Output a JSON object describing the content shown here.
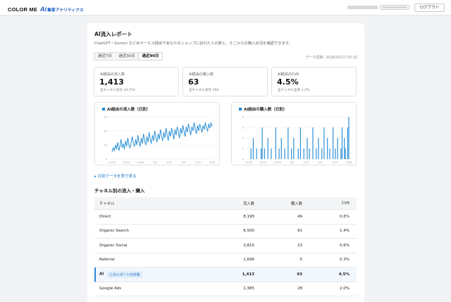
{
  "header": {
    "brand": "COLOR ME",
    "product_ai": "Ai",
    "product_name": "集客アナリティクス",
    "logout_label": "ログアウト"
  },
  "report": {
    "title": "AI流入レポート",
    "subtitle": "ChatGPT・Gemini などAIサービス経由であなたのショップに訪れた人の数と、そこからの購入状況を確認できます。",
    "periods": [
      "過近7日",
      "過近30日",
      "過近90日"
    ],
    "active_period": "過近90日",
    "updated": "データ更新: 2026/02/27 03:10"
  },
  "kpis": [
    {
      "label": "AI経由の流入数",
      "value": "1,413",
      "sub": "全チャネル合計 24,714"
    },
    {
      "label": "AI経由の購入数",
      "value": "63",
      "sub": "全チャネル合計 294"
    },
    {
      "label": "AI経由のCVR",
      "value": "4.5%",
      "sub": "全チャネル全体 1.2%"
    }
  ],
  "charts": {
    "visits_title": "AI経由の流入数（日別）",
    "purchases_title": "AI経由の購入数（日別）",
    "accent": "#1e88d4"
  },
  "chart_data": [
    {
      "type": "line",
      "title": "AI経由の流入数（日別）",
      "x_ticks": [
        "11/29",
        "12/12",
        "12/26",
        "1/8",
        "1/22",
        "2/5",
        "2/19",
        "2/26"
      ],
      "y_ticks": [
        0,
        10,
        20,
        30
      ],
      "ylim": [
        0,
        30
      ],
      "values": [
        5,
        8,
        6,
        10,
        7,
        12,
        6,
        9,
        14,
        8,
        11,
        7,
        13,
        9,
        15,
        10,
        8,
        12,
        16,
        11,
        9,
        14,
        10,
        17,
        12,
        9,
        15,
        11,
        18,
        13,
        10,
        16,
        12,
        19,
        14,
        11,
        17,
        13,
        20,
        15,
        12,
        18,
        14,
        21,
        16,
        13,
        19,
        15,
        22,
        17,
        13,
        20,
        16,
        22,
        18,
        14,
        21,
        17,
        23,
        19,
        15,
        22,
        18,
        24,
        20,
        16,
        23,
        19,
        25,
        21,
        17,
        23,
        20,
        26,
        21,
        18,
        24,
        20,
        25,
        22,
        19,
        24,
        21,
        26,
        22,
        20,
        25,
        22,
        26,
        23
      ]
    },
    {
      "type": "bar",
      "title": "AI経由の購入数（日別）",
      "x_ticks": [
        "11/29",
        "12/12",
        "12/26",
        "1/8",
        "1/22",
        "2/5",
        "2/19",
        "2/26"
      ],
      "y_ticks": [
        0,
        1,
        2,
        3,
        4
      ],
      "ylim": [
        0,
        4
      ],
      "values": [
        0,
        0,
        1,
        0,
        2,
        0,
        0,
        1,
        0,
        0,
        0,
        1,
        3,
        0,
        1,
        0,
        0,
        2,
        0,
        0,
        1,
        0,
        0,
        0,
        3,
        0,
        0,
        1,
        0,
        2,
        0,
        0,
        1,
        0,
        0,
        3,
        0,
        0,
        1,
        0,
        2,
        0,
        0,
        0,
        1,
        0,
        3,
        0,
        0,
        1,
        0,
        0,
        2,
        0,
        1,
        0,
        0,
        3,
        0,
        0,
        1,
        0,
        2,
        0,
        0,
        1,
        0,
        3,
        0,
        0,
        2,
        0,
        1,
        0,
        0,
        3,
        0,
        1,
        0,
        2,
        0,
        0,
        1,
        3,
        0,
        2,
        1,
        0,
        3,
        4
      ]
    }
  ],
  "daily_link": "日別データを表で見る",
  "channel_section": {
    "title": "チャネル別の流入・購入",
    "columns": [
      "チャネル",
      "流入数",
      "購入数",
      "CVR"
    ],
    "rows": [
      {
        "channel": "Direct",
        "visits": "8,195",
        "purchases": "49",
        "cvr": "0.6%"
      },
      {
        "channel": "Organic Search",
        "visits": "6,500",
        "purchases": "91",
        "cvr": "1.4%"
      },
      {
        "channel": "Organic Social",
        "visits": "3,815",
        "purchases": "23",
        "cvr": "0.6%"
      },
      {
        "channel": "Referral",
        "visits": "1,696",
        "purchases": "5",
        "cvr": "0.3%"
      },
      {
        "channel": "AI",
        "tag": "このレポートの対象",
        "visits": "1,413",
        "purchases": "63",
        "cvr": "4.5%"
      },
      {
        "channel": "Google Ads",
        "visits": "1,385",
        "purchases": "28",
        "cvr": "2.0%"
      }
    ]
  }
}
